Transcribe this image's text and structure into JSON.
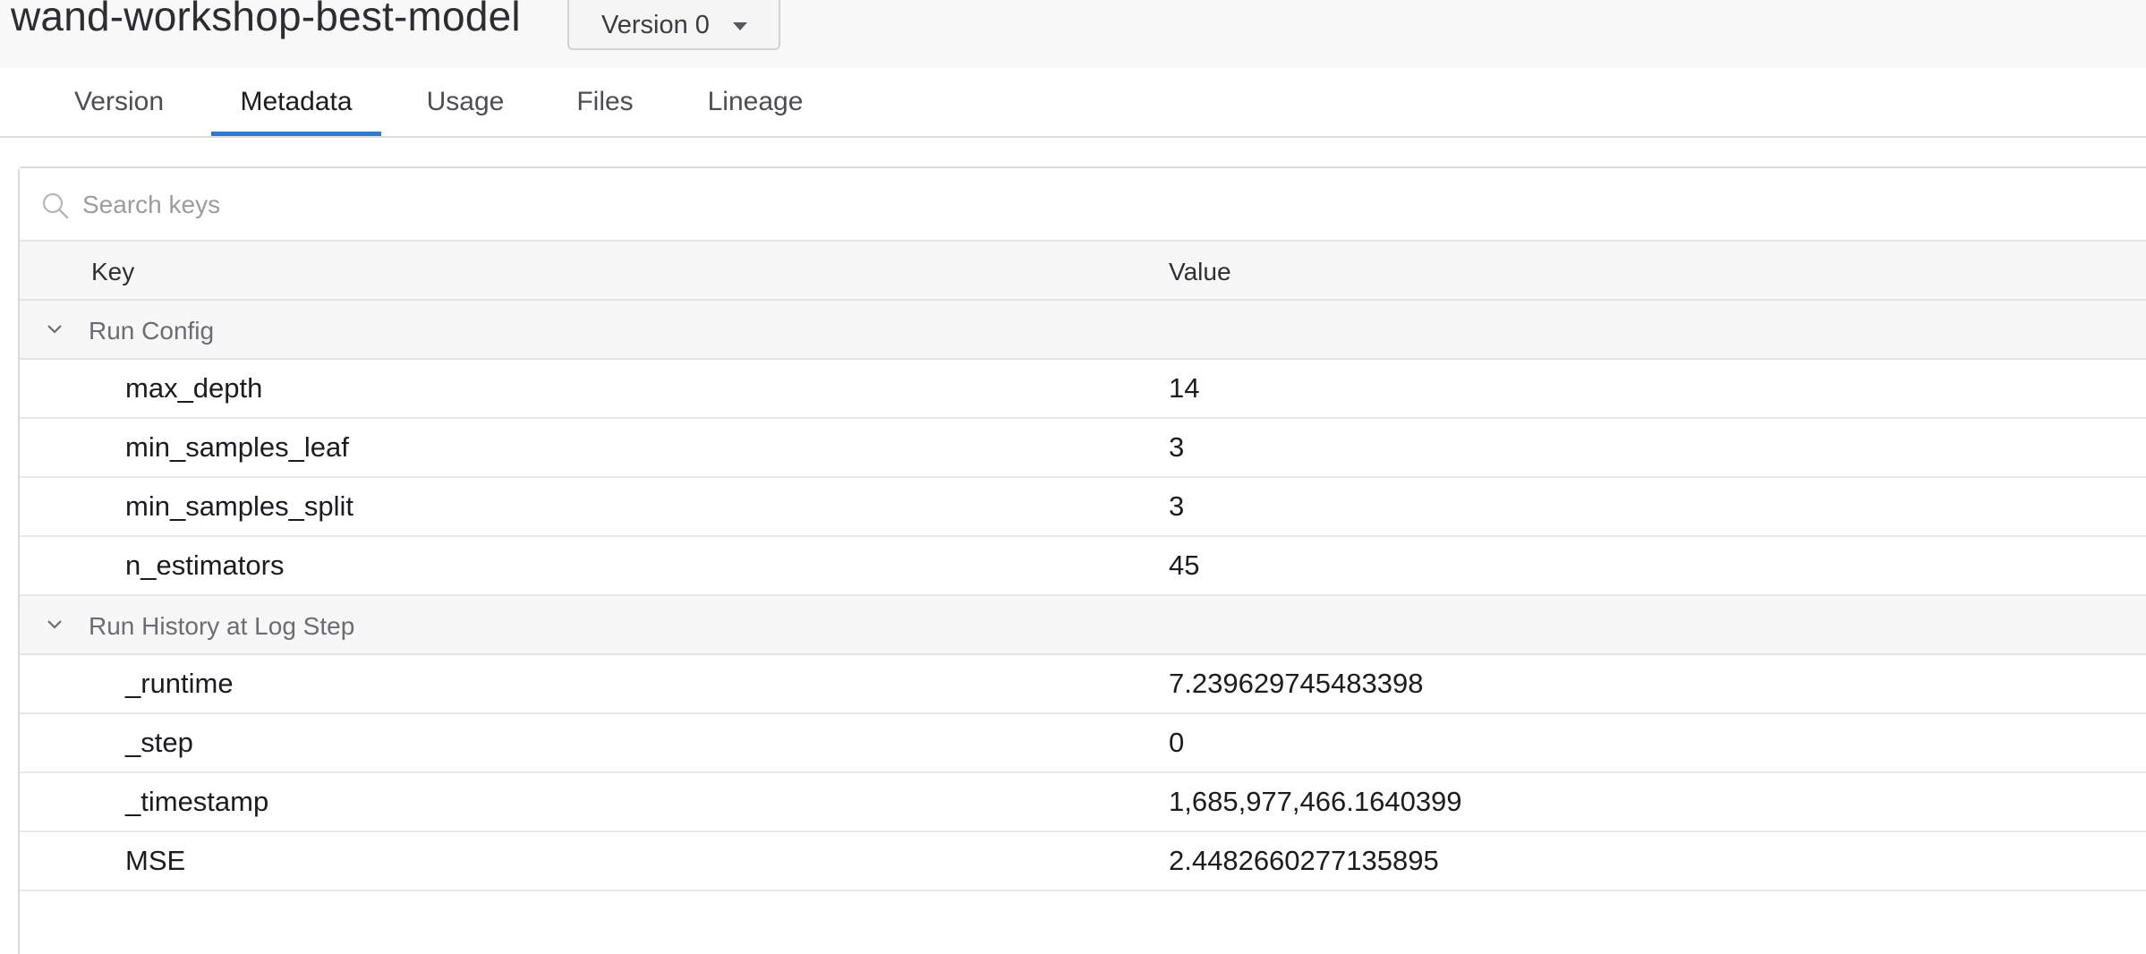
{
  "header": {
    "title": "wand-workshop-best-model",
    "version_label": "Version 0"
  },
  "tabs": [
    {
      "label": "Version"
    },
    {
      "label": "Metadata"
    },
    {
      "label": "Usage"
    },
    {
      "label": "Files"
    },
    {
      "label": "Lineage"
    }
  ],
  "active_tab": "Metadata",
  "search": {
    "placeholder": "Search keys",
    "value": ""
  },
  "table": {
    "key_header": "Key",
    "value_header": "Value",
    "groups": [
      {
        "label": "Run Config",
        "rows": [
          {
            "key": "max_depth",
            "value": "14"
          },
          {
            "key": "min_samples_leaf",
            "value": "3"
          },
          {
            "key": "min_samples_split",
            "value": "3"
          },
          {
            "key": "n_estimators",
            "value": "45"
          }
        ]
      },
      {
        "label": "Run History at Log Step",
        "rows": [
          {
            "key": "_runtime",
            "value": "7.239629745483398"
          },
          {
            "key": "_step",
            "value": "0"
          },
          {
            "key": "_timestamp",
            "value": "1,685,977,466.1640399"
          },
          {
            "key": "MSE",
            "value": "2.4482660277135895"
          }
        ]
      }
    ]
  },
  "colors": {
    "accent": "#2b7bd6"
  },
  "icons": {
    "search": "search-icon",
    "chevron": "chevron-down-icon",
    "dropdown": "caret-down-icon"
  }
}
